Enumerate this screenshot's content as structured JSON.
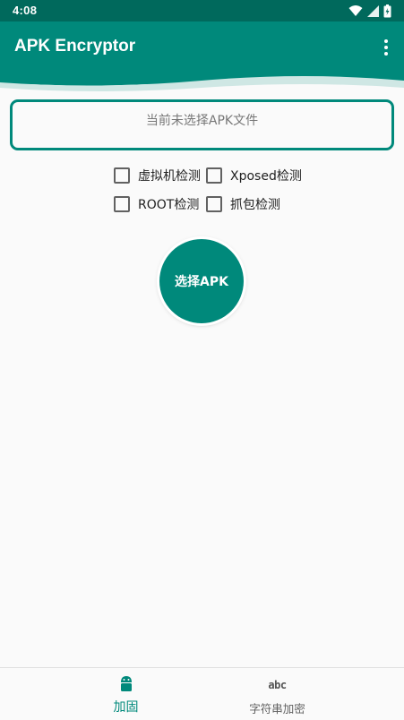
{
  "status_bar": {
    "time": "4:08",
    "icons": [
      "wifi-icon",
      "signal-icon",
      "battery-icon"
    ]
  },
  "app_bar": {
    "title": "APK Encryptor",
    "menu_icon": "more-vert-icon",
    "color": "#00897b",
    "status_color": "#00695c"
  },
  "file_box": {
    "text": "当前未选择APK文件"
  },
  "options": [
    {
      "label": "虚拟机检测",
      "checked": false
    },
    {
      "label": "Xposed检测",
      "checked": false
    },
    {
      "label": "ROOT检测",
      "checked": false
    },
    {
      "label": "抓包检测",
      "checked": false
    }
  ],
  "select_button": {
    "label": "选择APK"
  },
  "bottom_nav": {
    "items": [
      {
        "label": "加固",
        "icon": "android-icon",
        "active": true
      },
      {
        "label": "字符串加密",
        "icon": "abc-icon",
        "icon_text": "abc",
        "active": false
      }
    ]
  }
}
